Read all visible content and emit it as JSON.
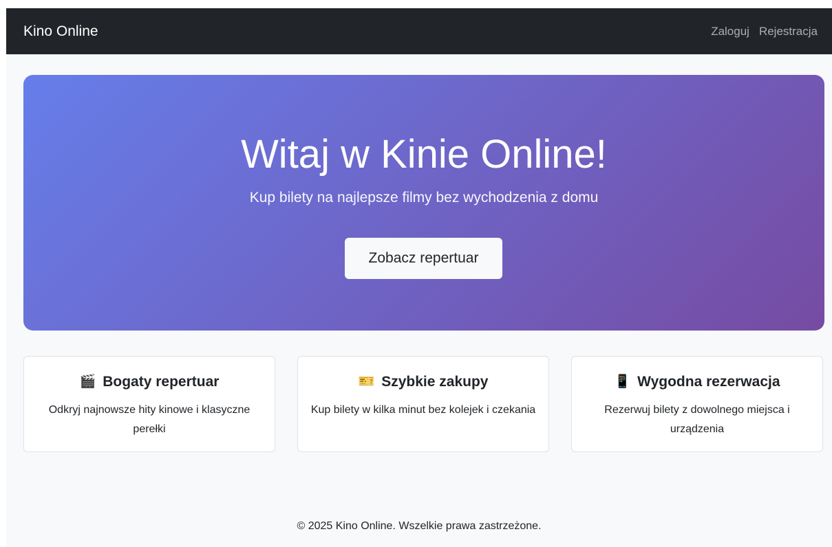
{
  "navbar": {
    "brand": "Kino Online",
    "links": [
      {
        "label": "Zaloguj"
      },
      {
        "label": "Rejestracja"
      }
    ]
  },
  "hero": {
    "title": "Witaj w Kinie Online!",
    "subtitle": "Kup bilety na najlepsze filmy bez wychodzenia z domu",
    "button_label": "Zobacz repertuar",
    "gradient_start": "#667eea",
    "gradient_end": "#764ba2"
  },
  "features": [
    {
      "icon": "clapperboard-icon",
      "icon_glyph": "🎬",
      "title": "Bogaty repertuar",
      "text": "Odkryj najnowsze hity kinowe i klasyczne perełki"
    },
    {
      "icon": "ticket-icon",
      "icon_glyph": "🎫",
      "title": "Szybkie zakupy",
      "text": "Kup bilety w kilka minut bez kolejek i czekania"
    },
    {
      "icon": "mobile-phone-icon",
      "icon_glyph": "📱",
      "title": "Wygodna rezerwacja",
      "text": "Rezerwuj bilety z dowolnego miejsca i urządzenia"
    }
  ],
  "footer": {
    "text": "© 2025 Kino Online. Wszelkie prawa zastrzeżone."
  },
  "colors": {
    "navbar_bg": "#212529",
    "page_bg": "#f8f9fa",
    "text_dark": "#212529"
  }
}
